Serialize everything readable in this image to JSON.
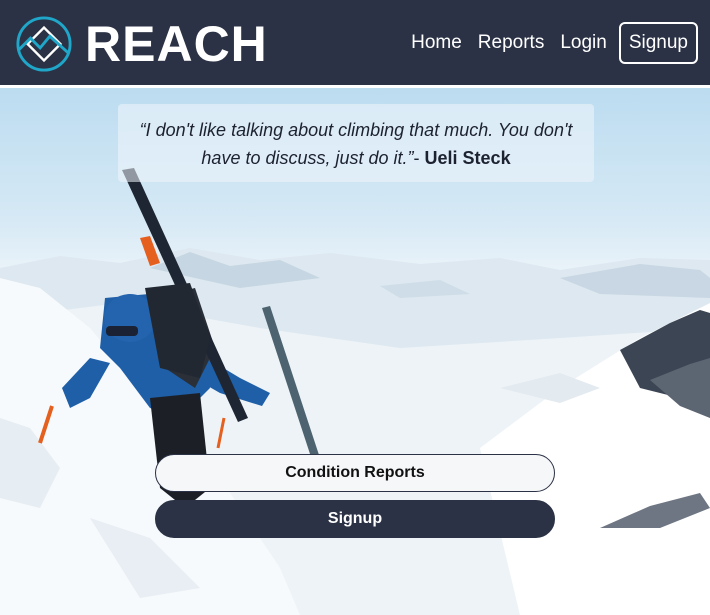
{
  "brand": {
    "name": "REACH",
    "logo_icon": "mountain-diamond-icon",
    "accent": "#1fa6c8"
  },
  "nav": {
    "home": "Home",
    "reports": "Reports",
    "login": "Login",
    "signup": "Signup"
  },
  "hero": {
    "quote": "“I don't like talking about climbing that much. You don't have to discuss, just do it.”",
    "dash": "- ",
    "author": "Ueli Steck",
    "condition_reports_button": "Condition Reports",
    "signup_button": "Signup"
  },
  "colors": {
    "navbar": "#2b3245",
    "button_dark": "#2b3245",
    "button_light": "#f6f7f9"
  }
}
